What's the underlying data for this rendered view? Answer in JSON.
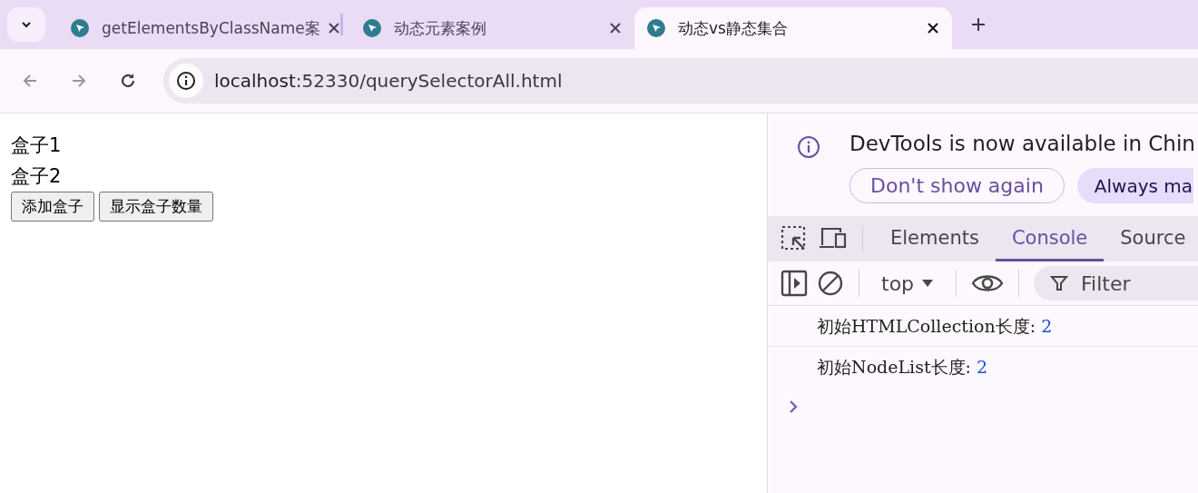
{
  "tabs": [
    {
      "title": "getElementsByClassName案",
      "selected": false
    },
    {
      "title": "动态元素案例",
      "selected": false
    },
    {
      "title": "动态vs静态集合",
      "selected": true
    }
  ],
  "address_bar": {
    "host": "localhost",
    "path": ":52330/querySelectorAll.html"
  },
  "page": {
    "boxes": [
      "盒子1",
      "盒子2"
    ],
    "buttons": [
      "添加盒子",
      "显示盒子数量"
    ]
  },
  "devtools": {
    "infobar": {
      "message": "DevTools is now available in Chin",
      "buttons": [
        {
          "label": "Don't show again",
          "kind": "outline"
        },
        {
          "label": "Always ma",
          "kind": "filled"
        }
      ]
    },
    "tabs": [
      {
        "label": "Elements",
        "selected": false
      },
      {
        "label": "Console",
        "selected": true
      },
      {
        "label": "Source",
        "selected": false
      }
    ],
    "context": "top",
    "filter": {
      "placeholder": "Filter"
    },
    "console": [
      {
        "text": "初始HTMLCollection长度: ",
        "value": "2"
      },
      {
        "text": "初始NodeList长度: ",
        "value": "2"
      }
    ]
  }
}
